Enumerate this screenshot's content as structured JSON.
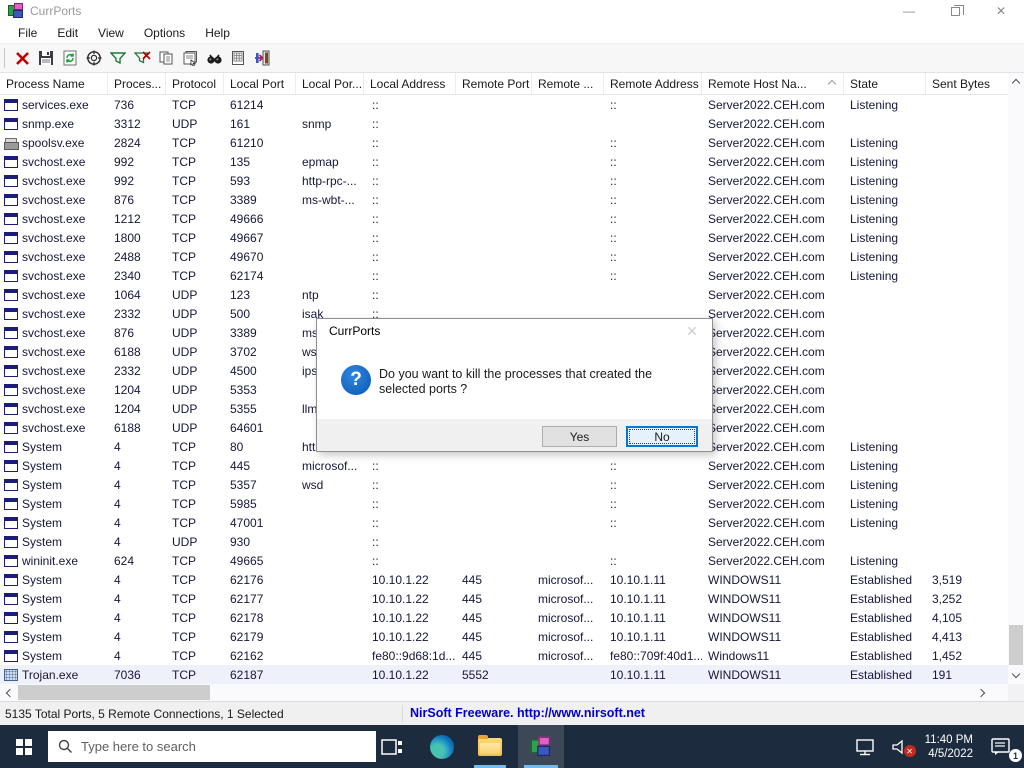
{
  "window": {
    "title": "CurrPorts"
  },
  "menu": {
    "items": [
      "File",
      "Edit",
      "View",
      "Options",
      "Help"
    ]
  },
  "toolbar": {
    "icons": [
      "kill-process-icon",
      "save-icon",
      "refresh-icon",
      "scope-icon",
      "filter-icon",
      "clear-filter-icon",
      "copy-icon",
      "properties-icon",
      "find-icon",
      "report-icon",
      "exit-icon"
    ]
  },
  "table": {
    "columns": [
      "Process Name",
      "Proces...",
      "Protocol",
      "Local Port",
      "Local Por...",
      "Local Address",
      "Remote Port",
      "Remote ...",
      "Remote Address",
      "Remote Host Na...",
      "State",
      "Sent Bytes"
    ],
    "rows": [
      {
        "ic": "window",
        "n": "services.exe",
        "pid": "736",
        "pr": "TCP",
        "lp": "61214",
        "lpn": "",
        "la": "::",
        "rp": "",
        "rpn": "",
        "ra": "::",
        "rh": "Server2022.CEH.com",
        "st": "Listening",
        "sb": ""
      },
      {
        "ic": "window",
        "n": "snmp.exe",
        "pid": "3312",
        "pr": "UDP",
        "lp": "161",
        "lpn": "snmp",
        "la": "::",
        "rp": "",
        "rpn": "",
        "ra": "",
        "rh": "Server2022.CEH.com",
        "st": "",
        "sb": ""
      },
      {
        "ic": "printer",
        "n": "spoolsv.exe",
        "pid": "2824",
        "pr": "TCP",
        "lp": "61210",
        "lpn": "",
        "la": "::",
        "rp": "",
        "rpn": "",
        "ra": "::",
        "rh": "Server2022.CEH.com",
        "st": "Listening",
        "sb": ""
      },
      {
        "ic": "window",
        "n": "svchost.exe",
        "pid": "992",
        "pr": "TCP",
        "lp": "135",
        "lpn": "epmap",
        "la": "::",
        "rp": "",
        "rpn": "",
        "ra": "::",
        "rh": "Server2022.CEH.com",
        "st": "Listening",
        "sb": ""
      },
      {
        "ic": "window",
        "n": "svchost.exe",
        "pid": "992",
        "pr": "TCP",
        "lp": "593",
        "lpn": "http-rpc-...",
        "la": "::",
        "rp": "",
        "rpn": "",
        "ra": "::",
        "rh": "Server2022.CEH.com",
        "st": "Listening",
        "sb": ""
      },
      {
        "ic": "window",
        "n": "svchost.exe",
        "pid": "876",
        "pr": "TCP",
        "lp": "3389",
        "lpn": "ms-wbt-...",
        "la": "::",
        "rp": "",
        "rpn": "",
        "ra": "::",
        "rh": "Server2022.CEH.com",
        "st": "Listening",
        "sb": ""
      },
      {
        "ic": "window",
        "n": "svchost.exe",
        "pid": "1212",
        "pr": "TCP",
        "lp": "49666",
        "lpn": "",
        "la": "::",
        "rp": "",
        "rpn": "",
        "ra": "::",
        "rh": "Server2022.CEH.com",
        "st": "Listening",
        "sb": ""
      },
      {
        "ic": "window",
        "n": "svchost.exe",
        "pid": "1800",
        "pr": "TCP",
        "lp": "49667",
        "lpn": "",
        "la": "::",
        "rp": "",
        "rpn": "",
        "ra": "::",
        "rh": "Server2022.CEH.com",
        "st": "Listening",
        "sb": ""
      },
      {
        "ic": "window",
        "n": "svchost.exe",
        "pid": "2488",
        "pr": "TCP",
        "lp": "49670",
        "lpn": "",
        "la": "::",
        "rp": "",
        "rpn": "",
        "ra": "::",
        "rh": "Server2022.CEH.com",
        "st": "Listening",
        "sb": ""
      },
      {
        "ic": "window",
        "n": "svchost.exe",
        "pid": "2340",
        "pr": "TCP",
        "lp": "62174",
        "lpn": "",
        "la": "::",
        "rp": "",
        "rpn": "",
        "ra": "::",
        "rh": "Server2022.CEH.com",
        "st": "Listening",
        "sb": ""
      },
      {
        "ic": "window",
        "n": "svchost.exe",
        "pid": "1064",
        "pr": "UDP",
        "lp": "123",
        "lpn": "ntp",
        "la": "::",
        "rp": "",
        "rpn": "",
        "ra": "",
        "rh": "Server2022.CEH.com",
        "st": "",
        "sb": ""
      },
      {
        "ic": "window",
        "n": "svchost.exe",
        "pid": "2332",
        "pr": "UDP",
        "lp": "500",
        "lpn": "isak",
        "la": "::",
        "rp": "",
        "rpn": "",
        "ra": "",
        "rh": "Server2022.CEH.com",
        "st": "",
        "sb": ""
      },
      {
        "ic": "window",
        "n": "svchost.exe",
        "pid": "876",
        "pr": "UDP",
        "lp": "3389",
        "lpn": "ms",
        "la": "::",
        "rp": "",
        "rpn": "",
        "ra": "",
        "rh": "Server2022.CEH.com",
        "st": "",
        "sb": ""
      },
      {
        "ic": "window",
        "n": "svchost.exe",
        "pid": "6188",
        "pr": "UDP",
        "lp": "3702",
        "lpn": "ws-",
        "la": "::",
        "rp": "",
        "rpn": "",
        "ra": "",
        "rh": "Server2022.CEH.com",
        "st": "",
        "sb": ""
      },
      {
        "ic": "window",
        "n": "svchost.exe",
        "pid": "2332",
        "pr": "UDP",
        "lp": "4500",
        "lpn": "ips",
        "la": "::",
        "rp": "",
        "rpn": "",
        "ra": "",
        "rh": "Server2022.CEH.com",
        "st": "",
        "sb": ""
      },
      {
        "ic": "window",
        "n": "svchost.exe",
        "pid": "1204",
        "pr": "UDP",
        "lp": "5353",
        "lpn": "",
        "la": "::",
        "rp": "",
        "rpn": "",
        "ra": "",
        "rh": "Server2022.CEH.com",
        "st": "",
        "sb": ""
      },
      {
        "ic": "window",
        "n": "svchost.exe",
        "pid": "1204",
        "pr": "UDP",
        "lp": "5355",
        "lpn": "llm",
        "la": "::",
        "rp": "",
        "rpn": "",
        "ra": "",
        "rh": "Server2022.CEH.com",
        "st": "",
        "sb": ""
      },
      {
        "ic": "window",
        "n": "svchost.exe",
        "pid": "6188",
        "pr": "UDP",
        "lp": "64601",
        "lpn": "",
        "la": "::",
        "rp": "",
        "rpn": "",
        "ra": "",
        "rh": "Server2022.CEH.com",
        "st": "",
        "sb": ""
      },
      {
        "ic": "window",
        "n": "System",
        "pid": "4",
        "pr": "TCP",
        "lp": "80",
        "lpn": "htt",
        "la": "::",
        "rp": "",
        "rpn": "",
        "ra": "::",
        "rh": "Server2022.CEH.com",
        "st": "Listening",
        "sb": ""
      },
      {
        "ic": "window",
        "n": "System",
        "pid": "4",
        "pr": "TCP",
        "lp": "445",
        "lpn": "microsof...",
        "la": "::",
        "rp": "",
        "rpn": "",
        "ra": "::",
        "rh": "Server2022.CEH.com",
        "st": "Listening",
        "sb": ""
      },
      {
        "ic": "window",
        "n": "System",
        "pid": "4",
        "pr": "TCP",
        "lp": "5357",
        "lpn": "wsd",
        "la": "::",
        "rp": "",
        "rpn": "",
        "ra": "::",
        "rh": "Server2022.CEH.com",
        "st": "Listening",
        "sb": ""
      },
      {
        "ic": "window",
        "n": "System",
        "pid": "4",
        "pr": "TCP",
        "lp": "5985",
        "lpn": "",
        "la": "::",
        "rp": "",
        "rpn": "",
        "ra": "::",
        "rh": "Server2022.CEH.com",
        "st": "Listening",
        "sb": ""
      },
      {
        "ic": "window",
        "n": "System",
        "pid": "4",
        "pr": "TCP",
        "lp": "47001",
        "lpn": "",
        "la": "::",
        "rp": "",
        "rpn": "",
        "ra": "::",
        "rh": "Server2022.CEH.com",
        "st": "Listening",
        "sb": ""
      },
      {
        "ic": "window",
        "n": "System",
        "pid": "4",
        "pr": "UDP",
        "lp": "930",
        "lpn": "",
        "la": "::",
        "rp": "",
        "rpn": "",
        "ra": "",
        "rh": "Server2022.CEH.com",
        "st": "",
        "sb": ""
      },
      {
        "ic": "window",
        "n": "wininit.exe",
        "pid": "624",
        "pr": "TCP",
        "lp": "49665",
        "lpn": "",
        "la": "::",
        "rp": "",
        "rpn": "",
        "ra": "::",
        "rh": "Server2022.CEH.com",
        "st": "Listening",
        "sb": ""
      },
      {
        "ic": "window",
        "n": "System",
        "pid": "4",
        "pr": "TCP",
        "lp": "62176",
        "lpn": "",
        "la": "10.10.1.22",
        "rp": "445",
        "rpn": "microsof...",
        "ra": "10.10.1.11",
        "rh": "WINDOWS11",
        "st": "Established",
        "sb": "3,519"
      },
      {
        "ic": "window",
        "n": "System",
        "pid": "4",
        "pr": "TCP",
        "lp": "62177",
        "lpn": "",
        "la": "10.10.1.22",
        "rp": "445",
        "rpn": "microsof...",
        "ra": "10.10.1.11",
        "rh": "WINDOWS11",
        "st": "Established",
        "sb": "3,252"
      },
      {
        "ic": "window",
        "n": "System",
        "pid": "4",
        "pr": "TCP",
        "lp": "62178",
        "lpn": "",
        "la": "10.10.1.22",
        "rp": "445",
        "rpn": "microsof...",
        "ra": "10.10.1.11",
        "rh": "WINDOWS11",
        "st": "Established",
        "sb": "4,105"
      },
      {
        "ic": "window",
        "n": "System",
        "pid": "4",
        "pr": "TCP",
        "lp": "62179",
        "lpn": "",
        "la": "10.10.1.22",
        "rp": "445",
        "rpn": "microsof...",
        "ra": "10.10.1.11",
        "rh": "WINDOWS11",
        "st": "Established",
        "sb": "4,413"
      },
      {
        "ic": "window",
        "n": "System",
        "pid": "4",
        "pr": "TCP",
        "lp": "62162",
        "lpn": "",
        "la": "fe80::9d68:1d...",
        "rp": "445",
        "rpn": "microsof...",
        "ra": "fe80::709f:40d1...",
        "rh": "Windows11",
        "st": "Established",
        "sb": "1,452"
      },
      {
        "ic": "trojan",
        "n": "Trojan.exe",
        "pid": "7036",
        "pr": "TCP",
        "lp": "62187",
        "lpn": "",
        "la": "10.10.1.22",
        "rp": "5552",
        "rpn": "",
        "ra": "10.10.1.11",
        "rh": "WINDOWS11",
        "st": "Established",
        "sb": "191",
        "sel": true
      }
    ]
  },
  "dialog": {
    "title": "CurrPorts",
    "message": "Do you want to kill the processes that created the selected ports ?",
    "question_mark": "?",
    "yes_label": "Yes",
    "no_label": "No"
  },
  "statusbar": {
    "left": "5135 Total Ports, 5 Remote Connections, 1 Selected",
    "right": "NirSoft Freeware.  http://www.nirsoft.net"
  },
  "taskbar": {
    "search_placeholder": "Type here to search",
    "clock_time": "11:40 PM",
    "clock_date": "4/5/2022",
    "notification_badge": "1"
  },
  "colors": {
    "taskbar_bg": "#1c2b3d",
    "link_blue": "#0000cc",
    "focus_blue": "#0078d7",
    "selected_row_bg": "#eef1fa"
  }
}
